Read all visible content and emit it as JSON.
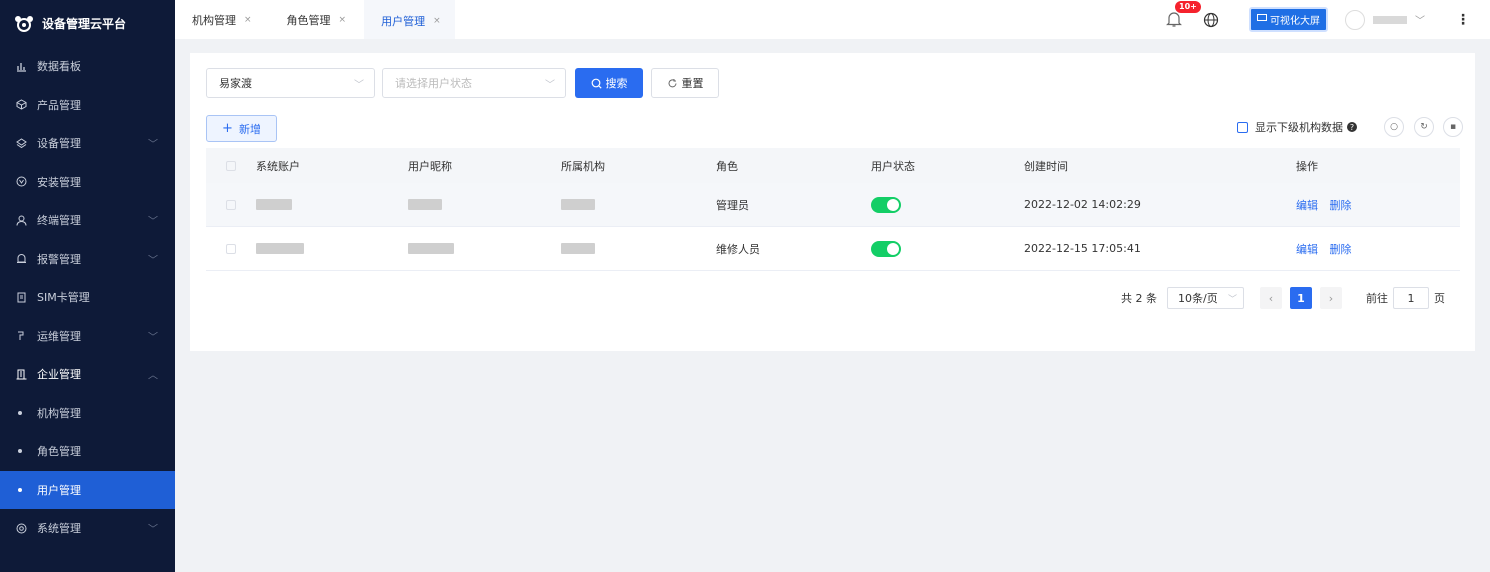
{
  "app": {
    "title": "设备管理云平台"
  },
  "sidebar": {
    "items": [
      {
        "label": "数据看板",
        "icon": "bar-chart-icon",
        "chevron": false
      },
      {
        "label": "产品管理",
        "icon": "cube-icon",
        "chevron": false
      },
      {
        "label": "设备管理",
        "icon": "layers-icon",
        "chevron": true
      },
      {
        "label": "安装管理",
        "icon": "install-icon",
        "chevron": false
      },
      {
        "label": "终端管理",
        "icon": "user-icon",
        "chevron": true
      },
      {
        "label": "报警管理",
        "icon": "alarm-icon",
        "chevron": true
      },
      {
        "label": "SIM卡管理",
        "icon": "sim-card-icon",
        "chevron": false
      },
      {
        "label": "运维管理",
        "icon": "wrench-icon",
        "chevron": true
      },
      {
        "label": "企业管理",
        "icon": "building-icon",
        "chevron": true,
        "expanded": true
      }
    ],
    "sub_items": [
      {
        "label": "机构管理"
      },
      {
        "label": "角色管理"
      },
      {
        "label": "用户管理",
        "active": true
      }
    ],
    "tail_items": [
      {
        "label": "系统管理",
        "icon": "settings-icon",
        "chevron": true
      }
    ]
  },
  "tabs": [
    {
      "label": "机构管理",
      "close": "×"
    },
    {
      "label": "角色管理",
      "close": "×"
    },
    {
      "label": "用户管理",
      "close": "×",
      "active": true
    }
  ],
  "header": {
    "notification_count": "10+",
    "bigscreen_label": "可视化大屏"
  },
  "filters": {
    "org_value": "易家渡",
    "status_placeholder": "请选择用户状态",
    "search_label": "搜索",
    "reset_label": "重置"
  },
  "toolbar": {
    "add_label": "新增",
    "show_sub_label": "显示下级机构数据"
  },
  "table": {
    "columns": [
      "系统账户",
      "用户昵称",
      "所属机构",
      "角色",
      "用户状态",
      "创建时间",
      "操作"
    ],
    "rows": [
      {
        "role": "管理员",
        "status_on": true,
        "created": "2022-12-02 14:02:29",
        "edit": "编辑",
        "delete": "删除"
      },
      {
        "role": "维修人员",
        "status_on": true,
        "created": "2022-12-15 17:05:41",
        "edit": "编辑",
        "delete": "删除"
      }
    ]
  },
  "pager": {
    "total": "共 2 条",
    "page_size": "10条/页",
    "current": "1",
    "goto_label": "前往",
    "goto_value": "1",
    "page_suffix": "页"
  },
  "colors": {
    "primary": "#2a6cf0",
    "sidebar_bg": "#0e1a38",
    "switch_on": "#13ce66",
    "badge": "#f5222d"
  }
}
